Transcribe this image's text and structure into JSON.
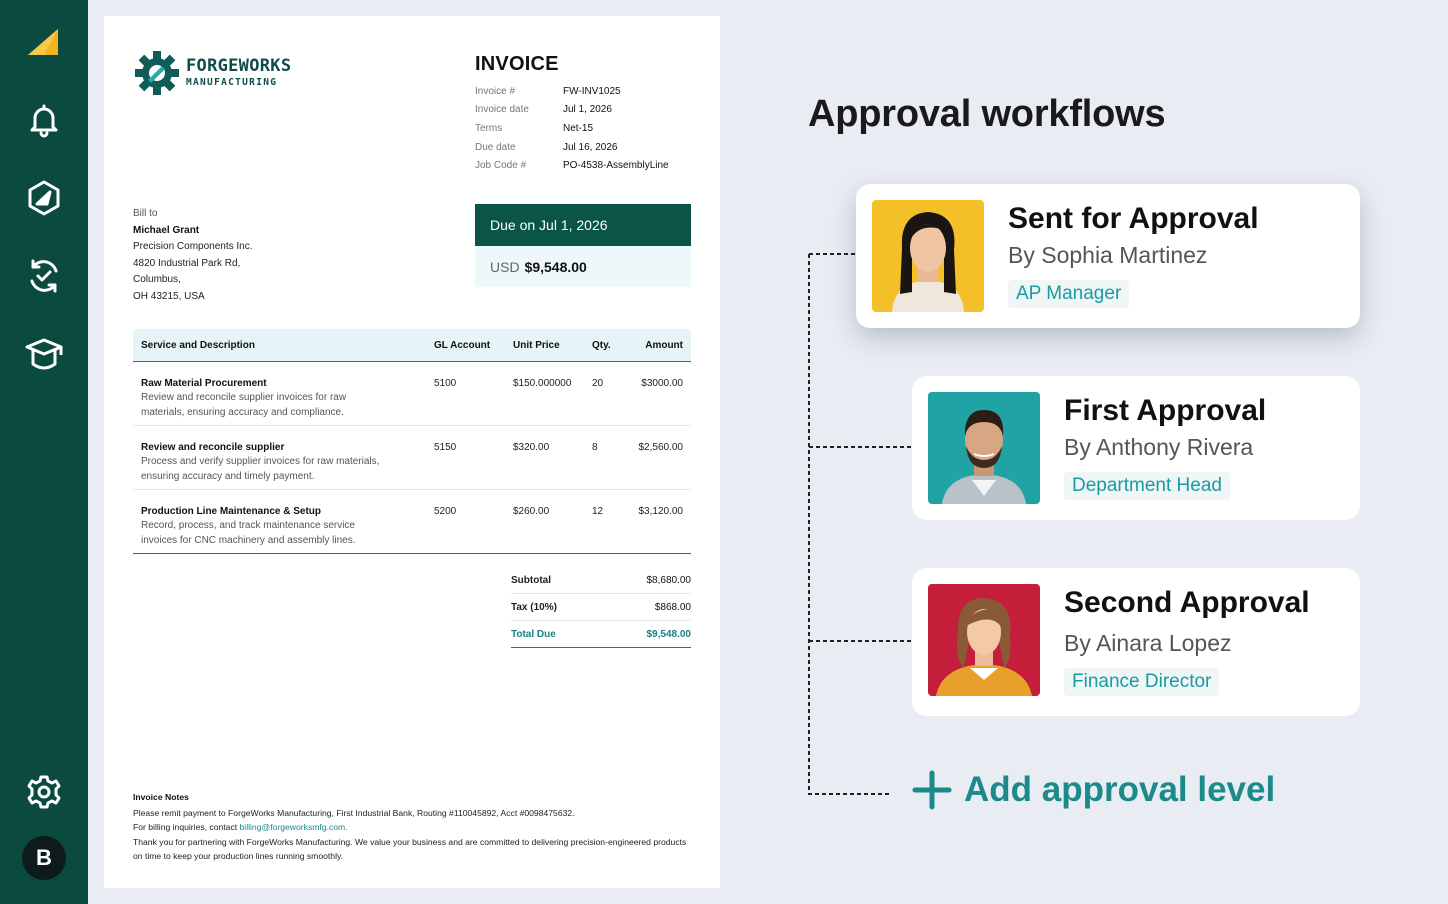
{
  "sidebar": {
    "icons": [
      "logo-mark-icon",
      "bell-icon",
      "compass-icon",
      "sync-check-icon",
      "graduation-cap-icon",
      "gear-icon"
    ],
    "avatar_initial": "B"
  },
  "invoice": {
    "logo": {
      "title": "FORGEWORKS",
      "subtitle": "MANUFACTURING"
    },
    "title": "INVOICE",
    "meta": [
      {
        "label": "Invoice #",
        "value": "FW-INV1025"
      },
      {
        "label": "Invoice date",
        "value": "Jul 1, 2026"
      },
      {
        "label": "Terms",
        "value": "Net-15"
      },
      {
        "label": "Due date",
        "value": "Jul 16, 2026"
      },
      {
        "label": "Job Code #",
        "value": "PO-4538-AssemblyLine"
      }
    ],
    "bill_to": {
      "label": "Bill to",
      "name": "Michael Grant",
      "lines": [
        "Precision Components Inc.",
        "4820 Industrial Park Rd,",
        "Columbus,",
        "OH 43215, USA"
      ]
    },
    "due": {
      "heading": "Due on Jul 1, 2026",
      "currency": "USD",
      "amount": "$9,548.00"
    },
    "columns": {
      "desc": "Service and Description",
      "gl": "GL Account",
      "unit": "Unit Price",
      "qty": "Qty.",
      "amount": "Amount"
    },
    "rows": [
      {
        "title": "Raw Material Procurement",
        "desc": "Review and reconcile supplier invoices for raw materials, ensuring accuracy and compliance.",
        "gl": "5100",
        "unit": "$150.000000",
        "qty": "20",
        "amount": "$3000.00"
      },
      {
        "title": "Review and reconcile supplier",
        "desc": "Process and verify supplier invoices for raw materials, ensuring accuracy and timely payment.",
        "gl": "5150",
        "unit": "$320.00",
        "qty": "8",
        "amount": "$2,560.00"
      },
      {
        "title": "Production Line Maintenance & Setup",
        "desc": "Record, process, and track maintenance service invoices for CNC machinery and assembly lines.",
        "gl": "5200",
        "unit": "$260.00",
        "qty": "12",
        "amount": "$3,120.00"
      }
    ],
    "totals": [
      {
        "label": "Subtotal",
        "value": "$8,680.00"
      },
      {
        "label": "Tax (10%)",
        "value": "$868.00"
      },
      {
        "label": "Total Due",
        "value": "$9,548.00"
      }
    ],
    "notes": {
      "title": "Invoice Notes",
      "line1": "Please remit payment to ForgeWorks Manufacturing, First Industrial Bank, Routing #110045892, Acct #0098475632.",
      "line2_prefix": "For billing inquiries, contact ",
      "line2_email": "billing@forgeworksmfg.com.",
      "line3": "Thank you for partnering with ForgeWorks Manufacturing. We value your business and are committed to delivering precision-engineered products on time to keep your production lines running smoothly."
    }
  },
  "workflow": {
    "title": "Approval workflows",
    "steps": [
      {
        "title": "Sent for Approval",
        "by": "By Sophia Martinez",
        "role": "AP Manager",
        "photo_bg": "#f4c02a"
      },
      {
        "title": "First Approval",
        "by": "By Anthony Rivera",
        "role": "Department Head",
        "photo_bg": "#1fa3a5"
      },
      {
        "title": "Second Approval",
        "by": "By Ainara Lopez",
        "role": "Finance Director",
        "photo_bg": "#c41e3a"
      }
    ],
    "add_label": "Add approval level"
  },
  "colors": {
    "sidebar": "#0a4a3f",
    "accent": "#1a8a8a",
    "due_header": "#0a5547"
  }
}
